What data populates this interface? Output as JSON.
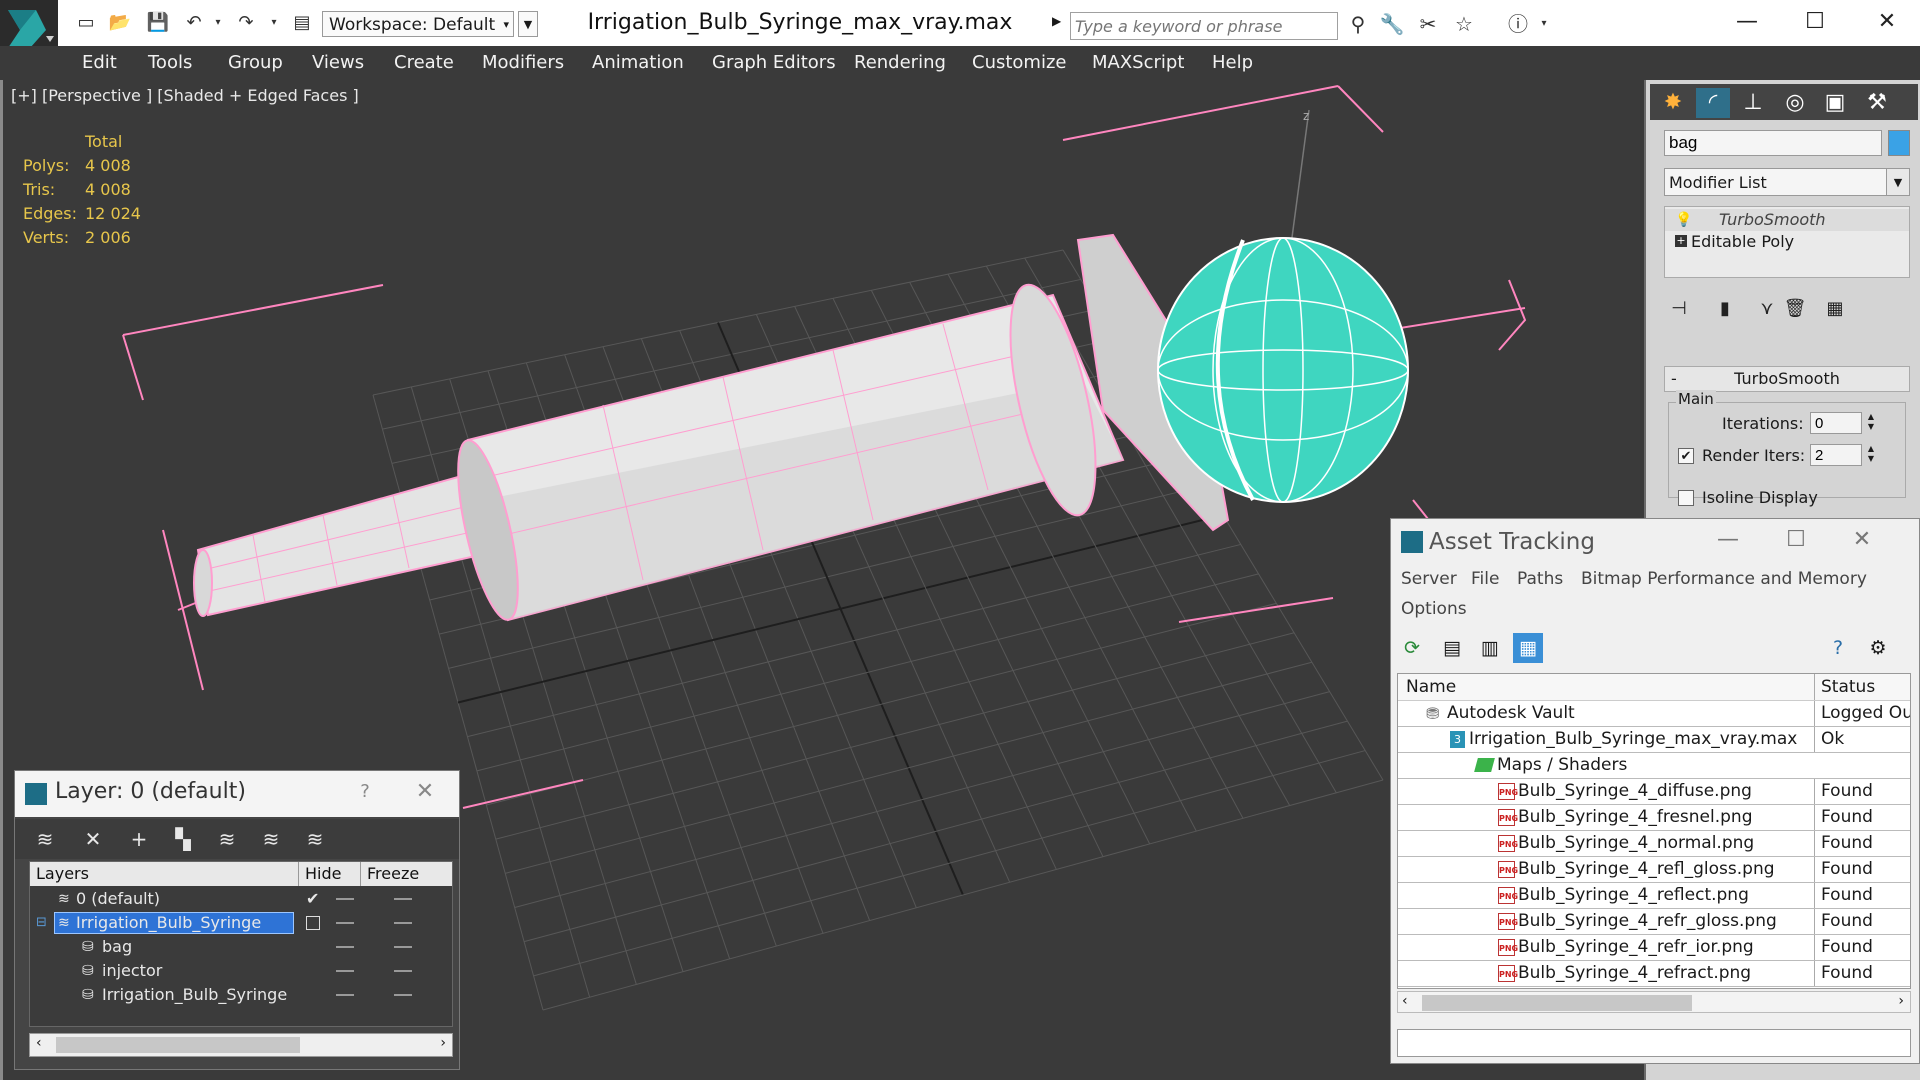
{
  "title_bar": {
    "workspace_label": "Workspace: Default",
    "document_title": "Irrigation_Bulb_Syringe_max_vray.max",
    "search_placeholder": "Type a keyword or phrase"
  },
  "menu": {
    "items": [
      "Edit",
      "Tools",
      "Group",
      "Views",
      "Create",
      "Modifiers",
      "Animation",
      "Graph Editors",
      "Rendering",
      "Customize",
      "MAXScript",
      "Help"
    ]
  },
  "viewport": {
    "label": "[+] [Perspective ] [Shaded + Edged Faces ]",
    "stats": {
      "header": "Total",
      "rows": [
        {
          "label": "Polys:",
          "value": "4 008"
        },
        {
          "label": "Tris:",
          "value": "4 008"
        },
        {
          "label": "Edges:",
          "value": "12 024"
        },
        {
          "label": "Verts:",
          "value": "2 006"
        }
      ]
    },
    "axis_label": "z",
    "colors": {
      "mesh_wire": "#ff9ed0",
      "bulb": "#3fd6c0",
      "body": "#e6e6e6",
      "grid": "#5a5a5a"
    }
  },
  "command_panel": {
    "object_name": "bag",
    "object_color": "#3aa2e6",
    "modifier_list_label": "Modifier List",
    "stack": [
      {
        "label": "TurboSmooth"
      },
      {
        "label": "Editable Poly"
      }
    ],
    "rollout_title": "TurboSmooth",
    "rollout_toggle": "-",
    "group_label": "Main",
    "iterations_label": "Iterations:",
    "iterations_value": "0",
    "render_iters_label": "Render Iters:",
    "render_iters_value": "2",
    "render_iters_checked": "✔",
    "isoline_label": "Isoline Display"
  },
  "asset_tracking": {
    "title": "Asset Tracking",
    "menu": [
      "Server",
      "File",
      "Paths",
      "Bitmap Performance and Memory",
      "Options"
    ],
    "columns": {
      "name": "Name",
      "status": "Status"
    },
    "png_badge": "PNG",
    "max_badge": "3",
    "rows": [
      {
        "name": "Autodesk Vault",
        "status": "Logged Out"
      },
      {
        "name": "Irrigation_Bulb_Syringe_max_vray.max",
        "status": "Ok"
      },
      {
        "name": "Maps / Shaders",
        "status": ""
      },
      {
        "name": "Bulb_Syringe_4_diffuse.png",
        "status": "Found"
      },
      {
        "name": "Bulb_Syringe_4_fresnel.png",
        "status": "Found"
      },
      {
        "name": "Bulb_Syringe_4_normal.png",
        "status": "Found"
      },
      {
        "name": "Bulb_Syringe_4_refl_gloss.png",
        "status": "Found"
      },
      {
        "name": "Bulb_Syringe_4_reflect.png",
        "status": "Found"
      },
      {
        "name": "Bulb_Syringe_4_refr_gloss.png",
        "status": "Found"
      },
      {
        "name": "Bulb_Syringe_4_refr_ior.png",
        "status": "Found"
      },
      {
        "name": "Bulb_Syringe_4_refract.png",
        "status": "Found"
      }
    ]
  },
  "layer_explorer": {
    "title": "Layer: 0 (default)",
    "help": "?",
    "columns": {
      "layers": "Layers",
      "hide": "Hide",
      "freeze": "Freeze"
    },
    "rows": [
      {
        "name": "0 (default)",
        "active_mark": "✔"
      },
      {
        "name": "Irrigation_Bulb_Syringe"
      },
      {
        "name": "bag"
      },
      {
        "name": "injector"
      },
      {
        "name": "Irrigation_Bulb_Syringe"
      }
    ]
  }
}
